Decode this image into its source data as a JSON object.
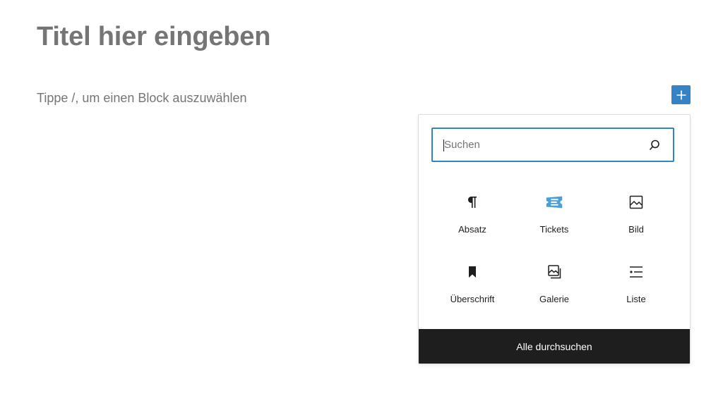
{
  "editor": {
    "title_placeholder": "Titel hier eingeben",
    "block_placeholder": "Tippe /, um einen Block auszuwählen"
  },
  "inserter": {
    "toggle_icon": "plus-icon",
    "search": {
      "placeholder": "Suchen",
      "value": "",
      "icon": "search-icon"
    },
    "blocks": [
      {
        "label": "Absatz",
        "icon": "paragraph-icon"
      },
      {
        "label": "Tickets",
        "icon": "tickets-icon"
      },
      {
        "label": "Bild",
        "icon": "image-icon"
      },
      {
        "label": "Überschrift",
        "icon": "bookmark-icon"
      },
      {
        "label": "Galerie",
        "icon": "gallery-icon"
      },
      {
        "label": "Liste",
        "icon": "list-icon"
      }
    ],
    "browse_all_label": "Alle durchsuchen"
  },
  "colors": {
    "accent": "#3582c4",
    "tickets_accent": "#4a9fd6",
    "text_muted": "#757575",
    "footer_bg": "#1e1e1e"
  }
}
